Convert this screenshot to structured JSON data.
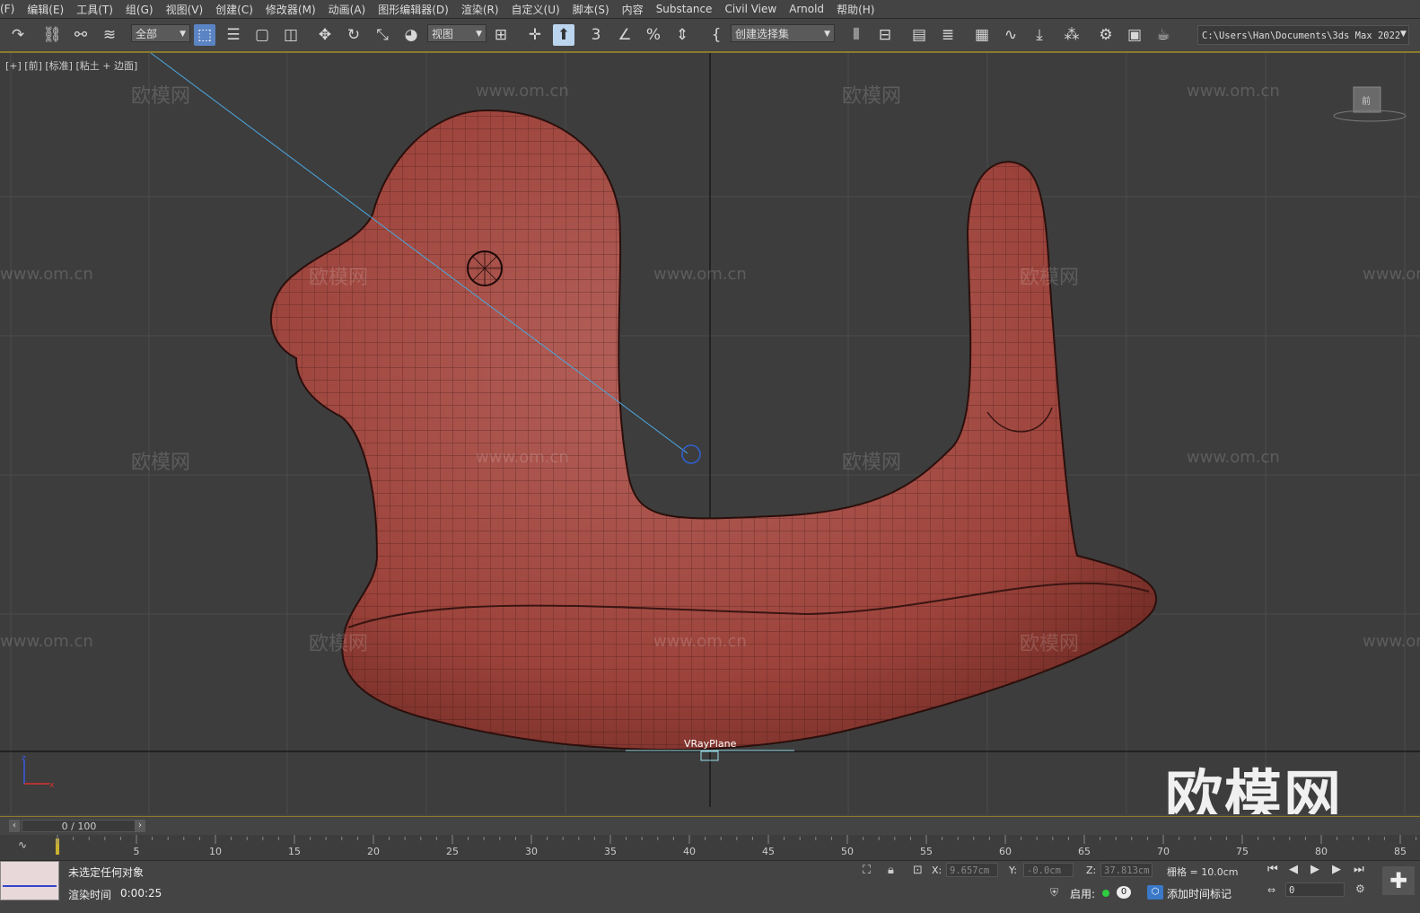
{
  "menu": {
    "items": [
      "(F)",
      "编辑(E)",
      "工具(T)",
      "组(G)",
      "视图(V)",
      "创建(C)",
      "修改器(M)",
      "动画(A)",
      "图形编辑器(D)",
      "渲染(R)",
      "自定义(U)",
      "脚本(S)",
      "内容",
      "Substance",
      "Civil View",
      "Arnold",
      "帮助(H)"
    ]
  },
  "toolbar": {
    "filter_dropdown": "全部",
    "ref_coord_dropdown": "视图",
    "named_selection_dropdown": "创建选择集",
    "snap_label": "3",
    "project_path": "C:\\Users\\Han\\Documents\\3ds Max 2022"
  },
  "viewport": {
    "label": "[+] [前] [标准] [粘土 + 边面]",
    "object_label": "VRayPlane",
    "watermark_text": "欧模网",
    "watermark_url": "www.om.cn",
    "viewcube_label": "前"
  },
  "timeline": {
    "frame_display": "0 / 100",
    "ticks": [
      "5",
      "10",
      "15",
      "20",
      "25",
      "30",
      "35",
      "40",
      "45",
      "50",
      "55",
      "60",
      "65",
      "70",
      "75",
      "80",
      "85"
    ]
  },
  "status": {
    "selection_message": "未选定任何对象",
    "render_time_label": "渲染时间",
    "render_time_value": "0:00:25",
    "x_label": "X:",
    "x_value": "9.657cm",
    "y_label": "Y:",
    "y_value": "-0.0cm",
    "z_label": "Z:",
    "z_value": "37.813cm",
    "grid_label": "栅格 = 10.0cm",
    "enable_label": "启用:",
    "enable_value": "0",
    "add_time_tag": "添加时间标记",
    "current_frame": "0"
  },
  "colors": {
    "model_fill": "#a4463f",
    "selection_accent": "#5b84c4",
    "timeline_accent": "#8a7a2a"
  }
}
